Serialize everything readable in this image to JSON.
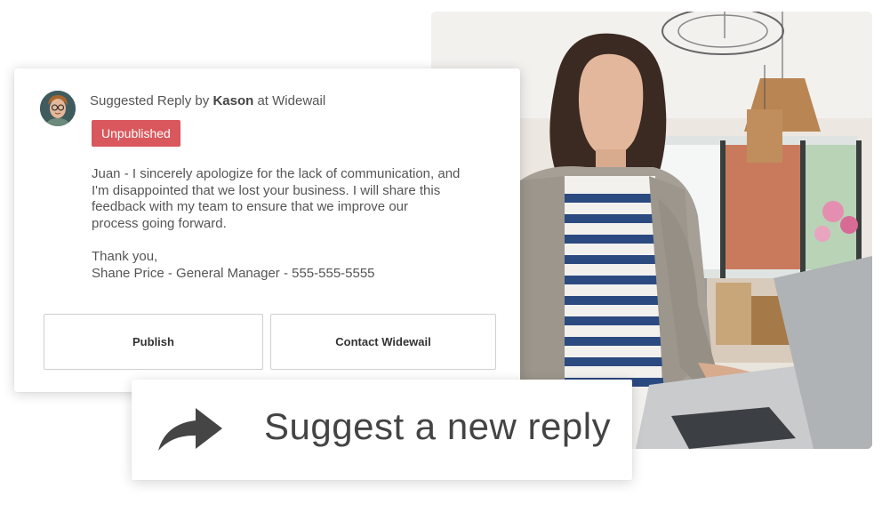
{
  "card": {
    "header_prefix": "Suggested Reply by",
    "header_author": "Kason",
    "header_at": "at",
    "header_company": "Widewail",
    "status_badge": "Unpublished",
    "reply_lines": [
      "Juan - I sincerely apologize for the lack of communication, and",
      "I'm disappointed that we lost your business. I will share this",
      "feedback with my team to ensure that we improve our",
      "process going forward."
    ],
    "signoff": "Thank you,",
    "signature": "Shane Price - General Manager - 555-555-5555",
    "publish_label": "Publish",
    "contact_label": "Contact Widewail"
  },
  "suggest": {
    "label": "Suggest a new reply",
    "icon": "share-arrow-icon"
  },
  "colors": {
    "badge": "#d9585d",
    "text": "#555555",
    "heading": "#444444"
  }
}
